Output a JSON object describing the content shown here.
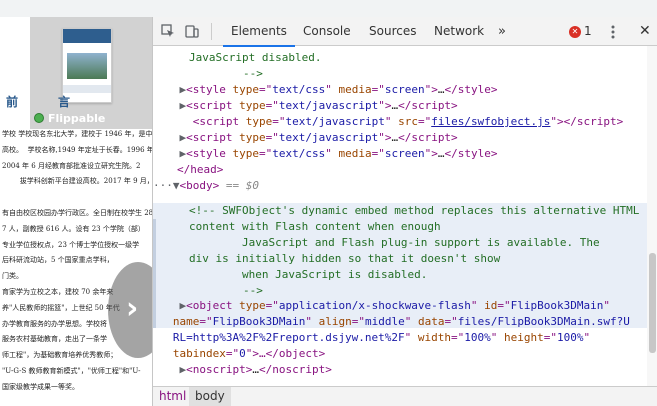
{
  "page": {
    "flippable_label": "Flippable",
    "preface_heading": "前　言",
    "body_lines": [
      "学校 学校现名东北大学，建校于 1946 年，是中",
      "高校。  学校名称,1949 年定址于长春。1996 年 9 月入",
      "2004 年 6 月经教育部批准设立研究生院。2",
      "        拔学科创新平台建设高校。2017 年 9 月，人",
      "",
      "有自由校区校园办学行政区。全日制在校学生 28",
      "7 人，副教授 616 人。设有 23 个学院（部）",
      "专业学位授权点，23 个博士学位授权一级学",
      "后科研流动站，5 个国家重点学科，",
      "门类。",
      "育家学为立校之本，建校 70 余年来",
      "养\"人民教师的摇篮\"，上世纪 50 年代",
      "办学教育服务的办学思想。学校将",
      "服务农村基础教育，走出了一条学",
      "师工程\"，为基础教育培养优秀教师；",
      "\"U-G-S 教师教育新模式\"，\"优师工程\"和\"U-",
      "国家级教学成果一等奖。"
    ]
  },
  "devtools": {
    "tabs": [
      "Elements",
      "Console",
      "Sources",
      "Network"
    ],
    "more_tabs_label": "»",
    "error_count": "1",
    "close_label": "✕",
    "breadcrumbs": [
      "html",
      "body"
    ],
    "dom_lines": {
      "l1": "JavaScript disabled.",
      "l2": "-->",
      "l3_tag": "style",
      "l3_attrs": [
        [
          "type",
          "text/css"
        ],
        [
          "media",
          "screen"
        ]
      ],
      "l4_tag": "script",
      "l4_attrs": [
        [
          "type",
          "text/javascript"
        ]
      ],
      "l5_tag": "script",
      "l5_type": "text/javascript",
      "l5_src": "files/swfobject.js",
      "l6_tag": "script",
      "l6_attrs": [
        [
          "type",
          "text/javascript"
        ]
      ],
      "l7_tag": "style",
      "l7_attrs": [
        [
          "type",
          "text/css"
        ],
        [
          "media",
          "screen"
        ]
      ],
      "head_close": "</head>",
      "body_line": "<body>",
      "body_eq": "== $0",
      "comment": [
        "<!-- SWFObject's dynamic embed method replaces this alternative HTML",
        "content with Flash content when enough",
        "        JavaScript and Flash plug-in support is available. The",
        "div is initially hidden so that it doesn't show",
        "        when JavaScript is disabled.",
        "-->"
      ],
      "object_attrs": [
        [
          "type",
          "application/x-shockwave-flash"
        ],
        [
          "id",
          "FlipBook3DMain"
        ],
        [
          "name",
          "FlipBook3DMain"
        ],
        [
          "align",
          "middle"
        ],
        [
          "data",
          "files/FlipBook3DMain.swf?URL=http%3A%2F%2Freport.dsjyw.net%2F"
        ],
        [
          "width",
          "100%"
        ],
        [
          "height",
          "100%"
        ],
        [
          "tabindex",
          "0"
        ]
      ],
      "noscript_tag": "noscript"
    }
  }
}
